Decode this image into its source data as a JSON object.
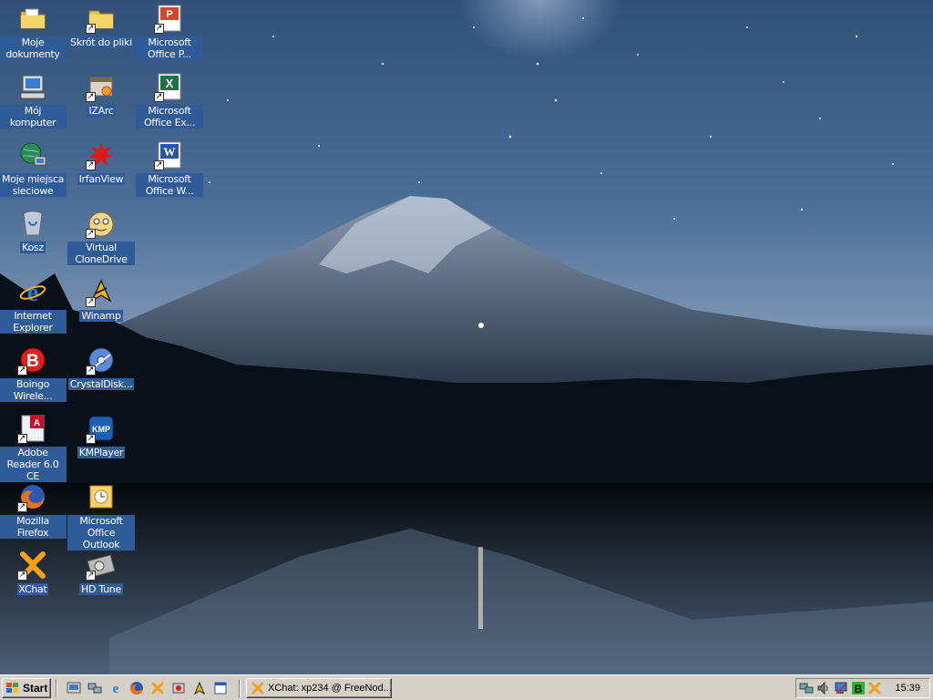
{
  "desktop": {
    "icons": [
      {
        "label": "Moje dokumenty",
        "icon": "my-documents-folder-icon"
      },
      {
        "label": "Skrót do pliki",
        "icon": "folder-icon",
        "shortcut": true
      },
      {
        "label": "Microsoft Office P...",
        "icon": "powerpoint-icon",
        "shortcut": true
      },
      {
        "label": "Mój komputer",
        "icon": "my-computer-icon"
      },
      {
        "label": "IZArc",
        "icon": "izarc-icon",
        "shortcut": true
      },
      {
        "label": "Microsoft Office Ex...",
        "icon": "excel-icon",
        "shortcut": true
      },
      {
        "label": "Moje miejsca sieciowe",
        "icon": "network-places-icon"
      },
      {
        "label": "IrfanView",
        "icon": "irfanview-icon",
        "shortcut": true
      },
      {
        "label": "Microsoft Office W...",
        "icon": "word-icon",
        "shortcut": true
      },
      {
        "label": "Kosz",
        "icon": "recycle-bin-icon"
      },
      {
        "label": "Virtual CloneDrive",
        "icon": "virtual-clonedrive-icon",
        "shortcut": true
      },
      {
        "label": "Internet Explorer",
        "icon": "internet-explorer-icon"
      },
      {
        "label": "Winamp",
        "icon": "winamp-icon",
        "shortcut": true
      },
      {
        "label": "Boingo Wirele...",
        "icon": "boingo-icon",
        "shortcut": true
      },
      {
        "label": "CrystalDisk...",
        "icon": "crystaldisk-icon",
        "shortcut": true
      },
      {
        "label": "Adobe Reader 6.0 CE",
        "icon": "adobe-reader-icon",
        "shortcut": true
      },
      {
        "label": "KMPlayer",
        "icon": "kmplayer-icon",
        "shortcut": true
      },
      {
        "label": "Mozilla Firefox",
        "icon": "firefox-icon",
        "shortcut": true
      },
      {
        "label": "Microsoft Office Outlook",
        "icon": "outlook-icon"
      },
      {
        "label": "XChat",
        "icon": "xchat-icon",
        "shortcut": true
      },
      {
        "label": "HD Tune",
        "icon": "hdtune-icon",
        "shortcut": true
      }
    ]
  },
  "taskbar": {
    "start_label": "Start",
    "quick_launch": [
      "show-desktop-icon",
      "network-icon",
      "internet-explorer-icon",
      "firefox-icon",
      "xchat-icon",
      "irfanview-icon",
      "winamp-icon",
      "window-icon"
    ],
    "task_buttons": [
      {
        "label": "XChat: xp234 @ FreeNod...",
        "icon": "xchat-icon"
      }
    ],
    "tray_icons": [
      "network-icon",
      "volume-icon",
      "display-icon",
      "boingo-icon",
      "xchat-icon"
    ],
    "clock": "15:39"
  },
  "colors": {
    "label_background": "#2f5b98",
    "taskbar": "#d4d0c8"
  }
}
